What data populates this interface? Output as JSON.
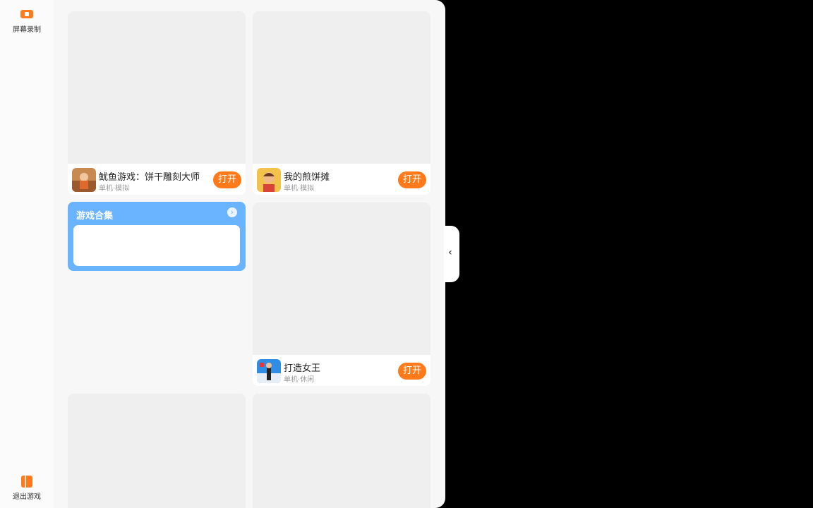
{
  "sidebar": {
    "record_label": "屏幕录制",
    "exit_label": "退出游戏"
  },
  "games": [
    {
      "name": "鱿鱼游戏：饼干雕刻大师",
      "tags": "单机·模拟",
      "open_label": "打开"
    },
    {
      "name": "我的煎饼摊",
      "tags": "单机·模拟",
      "open_label": "打开"
    },
    {
      "name": "打造女王",
      "tags": "单机·休闲",
      "open_label": "打开"
    }
  ],
  "collection": {
    "title": "游戏合集",
    "arrow_icon": "chevron-right-icon"
  },
  "colors": {
    "accent": "#ff7a1a",
    "collection_bg": "#69b3ff"
  }
}
